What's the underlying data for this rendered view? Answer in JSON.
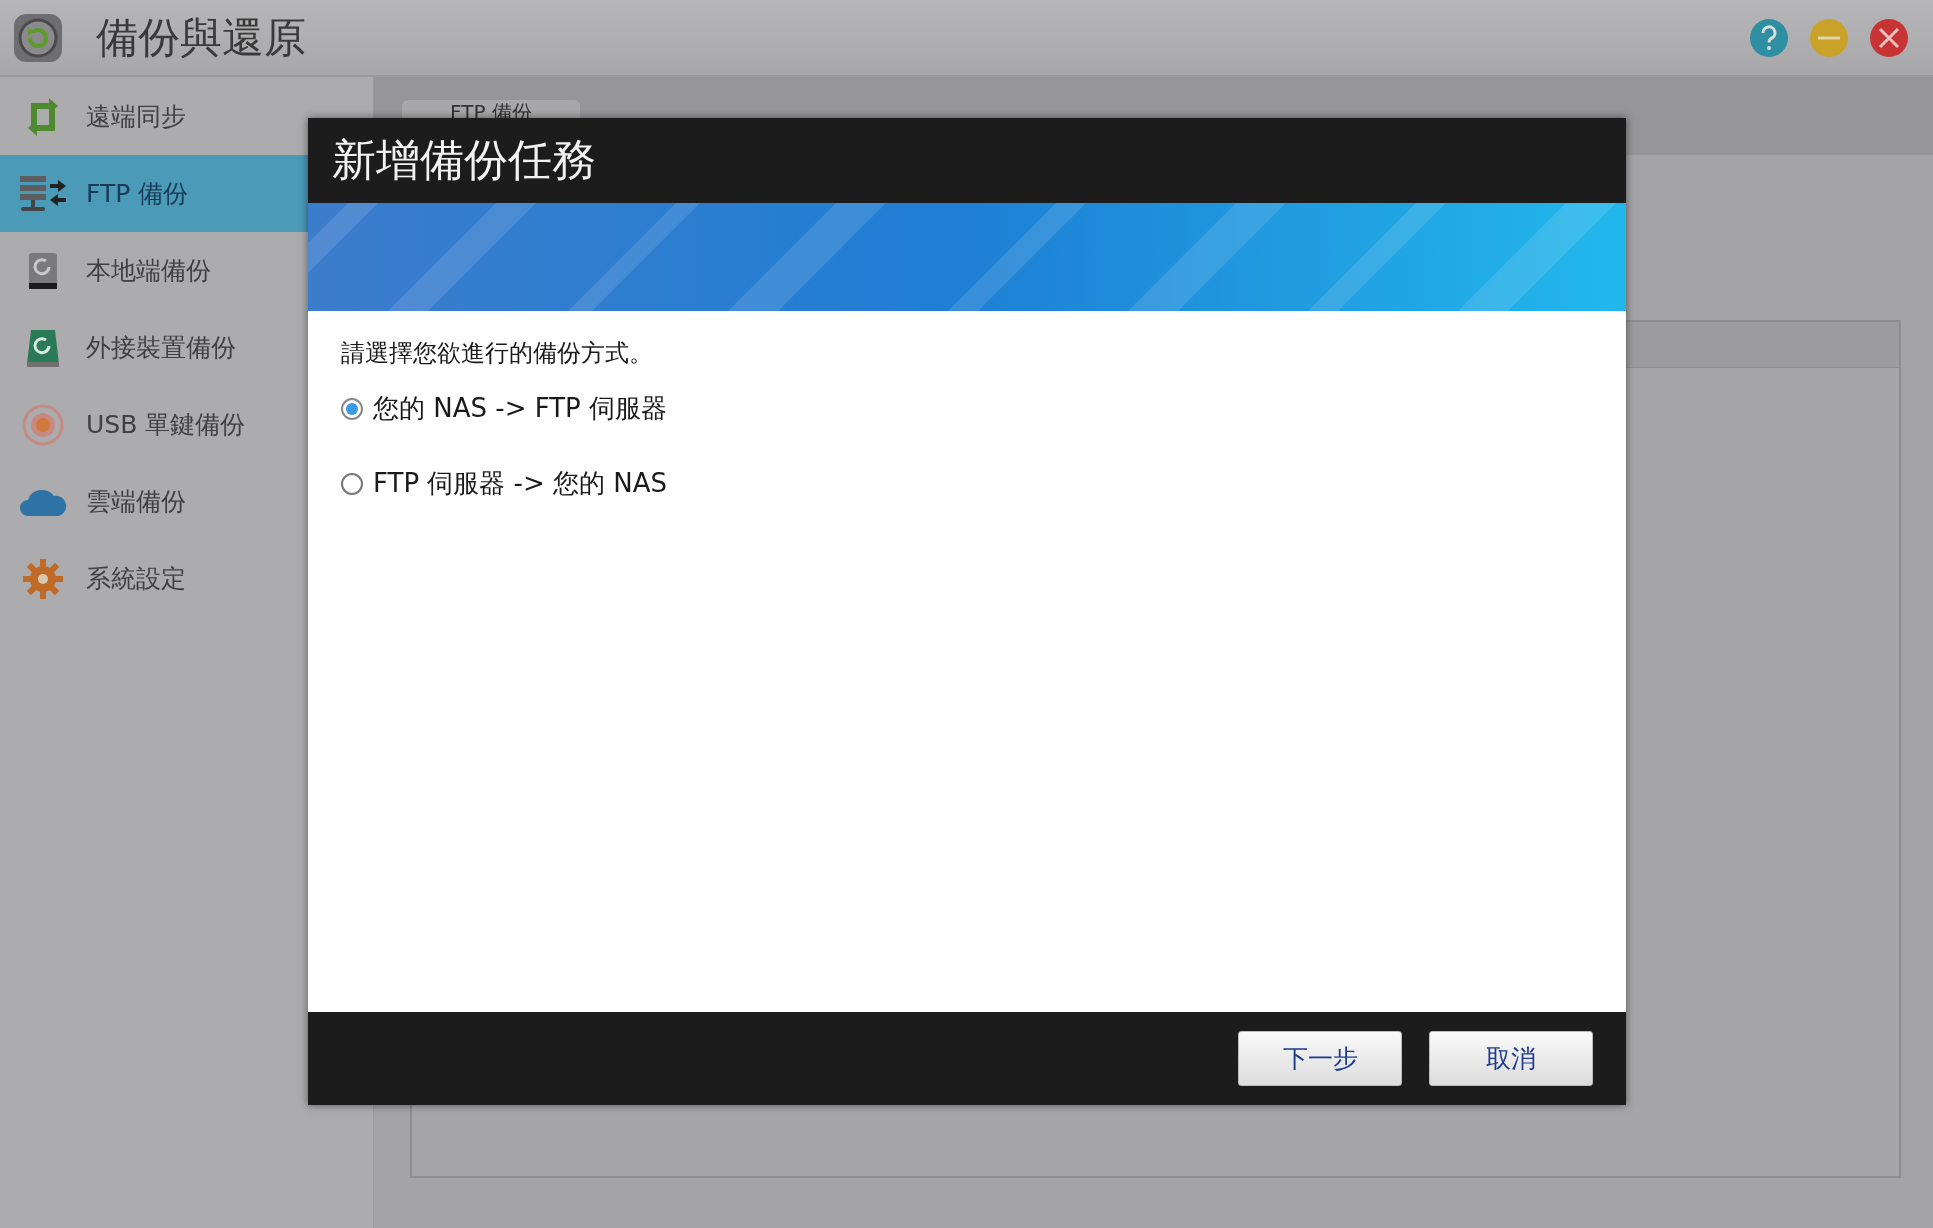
{
  "window": {
    "title": "備份與還原"
  },
  "sidebar": {
    "items": [
      {
        "label": "遠端同步",
        "kind": "sync",
        "selected": false
      },
      {
        "label": "FTP 備份",
        "kind": "ftp",
        "selected": true
      },
      {
        "label": "本地端備份",
        "kind": "local",
        "selected": false
      },
      {
        "label": "外接裝置備份",
        "kind": "external",
        "selected": false
      },
      {
        "label": "USB 單鍵備份",
        "kind": "usb",
        "selected": false
      },
      {
        "label": "雲端備份",
        "kind": "cloud",
        "selected": false
      },
      {
        "label": "系統設定",
        "kind": "settings",
        "selected": false
      }
    ]
  },
  "tabs": [
    {
      "label": "FTP 備份"
    }
  ],
  "dialog": {
    "title": "新增備份任務",
    "prompt": "請選擇您欲進行的備份方式。",
    "options": [
      {
        "label": "您的 NAS -> FTP 伺服器",
        "selected": true
      },
      {
        "label": "FTP 伺服器 -> 您的 NAS",
        "selected": false
      }
    ],
    "buttons": [
      "下一步",
      "取消"
    ]
  }
}
